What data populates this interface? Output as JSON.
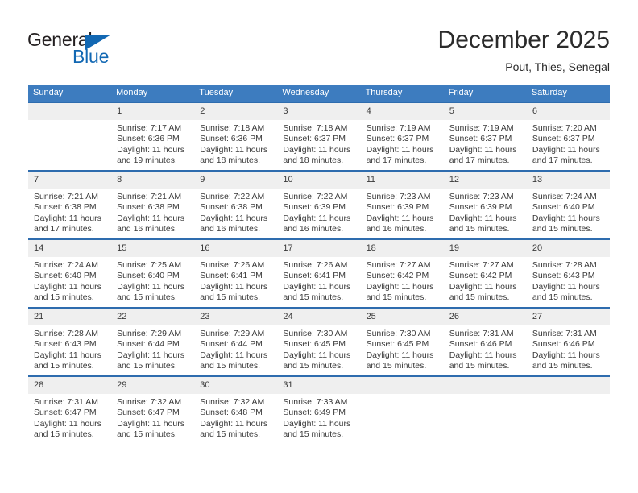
{
  "brand": {
    "name_top": "General",
    "name_bottom": "Blue",
    "triangle_color": "#1268b3",
    "text_color": "#231f20"
  },
  "header": {
    "month_title": "December 2025",
    "location": "Pout, Thies, Senegal"
  },
  "theme": {
    "header_blue": "#3d7cbf",
    "row_border_blue": "#2e6cae",
    "daynum_band": "#efefef",
    "text": "#3a3a3a"
  },
  "calendar": {
    "weekday_headers": [
      "Sunday",
      "Monday",
      "Tuesday",
      "Wednesday",
      "Thursday",
      "Friday",
      "Saturday"
    ],
    "weeks": [
      [
        {
          "day": "",
          "sunrise": "",
          "sunset": "",
          "daylight_line1": "",
          "daylight_line2": ""
        },
        {
          "day": "1",
          "sunrise": "Sunrise: 7:17 AM",
          "sunset": "Sunset: 6:36 PM",
          "daylight_line1": "Daylight: 11 hours",
          "daylight_line2": "and 19 minutes."
        },
        {
          "day": "2",
          "sunrise": "Sunrise: 7:18 AM",
          "sunset": "Sunset: 6:36 PM",
          "daylight_line1": "Daylight: 11 hours",
          "daylight_line2": "and 18 minutes."
        },
        {
          "day": "3",
          "sunrise": "Sunrise: 7:18 AM",
          "sunset": "Sunset: 6:37 PM",
          "daylight_line1": "Daylight: 11 hours",
          "daylight_line2": "and 18 minutes."
        },
        {
          "day": "4",
          "sunrise": "Sunrise: 7:19 AM",
          "sunset": "Sunset: 6:37 PM",
          "daylight_line1": "Daylight: 11 hours",
          "daylight_line2": "and 17 minutes."
        },
        {
          "day": "5",
          "sunrise": "Sunrise: 7:19 AM",
          "sunset": "Sunset: 6:37 PM",
          "daylight_line1": "Daylight: 11 hours",
          "daylight_line2": "and 17 minutes."
        },
        {
          "day": "6",
          "sunrise": "Sunrise: 7:20 AM",
          "sunset": "Sunset: 6:37 PM",
          "daylight_line1": "Daylight: 11 hours",
          "daylight_line2": "and 17 minutes."
        }
      ],
      [
        {
          "day": "7",
          "sunrise": "Sunrise: 7:21 AM",
          "sunset": "Sunset: 6:38 PM",
          "daylight_line1": "Daylight: 11 hours",
          "daylight_line2": "and 17 minutes."
        },
        {
          "day": "8",
          "sunrise": "Sunrise: 7:21 AM",
          "sunset": "Sunset: 6:38 PM",
          "daylight_line1": "Daylight: 11 hours",
          "daylight_line2": "and 16 minutes."
        },
        {
          "day": "9",
          "sunrise": "Sunrise: 7:22 AM",
          "sunset": "Sunset: 6:38 PM",
          "daylight_line1": "Daylight: 11 hours",
          "daylight_line2": "and 16 minutes."
        },
        {
          "day": "10",
          "sunrise": "Sunrise: 7:22 AM",
          "sunset": "Sunset: 6:39 PM",
          "daylight_line1": "Daylight: 11 hours",
          "daylight_line2": "and 16 minutes."
        },
        {
          "day": "11",
          "sunrise": "Sunrise: 7:23 AM",
          "sunset": "Sunset: 6:39 PM",
          "daylight_line1": "Daylight: 11 hours",
          "daylight_line2": "and 16 minutes."
        },
        {
          "day": "12",
          "sunrise": "Sunrise: 7:23 AM",
          "sunset": "Sunset: 6:39 PM",
          "daylight_line1": "Daylight: 11 hours",
          "daylight_line2": "and 15 minutes."
        },
        {
          "day": "13",
          "sunrise": "Sunrise: 7:24 AM",
          "sunset": "Sunset: 6:40 PM",
          "daylight_line1": "Daylight: 11 hours",
          "daylight_line2": "and 15 minutes."
        }
      ],
      [
        {
          "day": "14",
          "sunrise": "Sunrise: 7:24 AM",
          "sunset": "Sunset: 6:40 PM",
          "daylight_line1": "Daylight: 11 hours",
          "daylight_line2": "and 15 minutes."
        },
        {
          "day": "15",
          "sunrise": "Sunrise: 7:25 AM",
          "sunset": "Sunset: 6:40 PM",
          "daylight_line1": "Daylight: 11 hours",
          "daylight_line2": "and 15 minutes."
        },
        {
          "day": "16",
          "sunrise": "Sunrise: 7:26 AM",
          "sunset": "Sunset: 6:41 PM",
          "daylight_line1": "Daylight: 11 hours",
          "daylight_line2": "and 15 minutes."
        },
        {
          "day": "17",
          "sunrise": "Sunrise: 7:26 AM",
          "sunset": "Sunset: 6:41 PM",
          "daylight_line1": "Daylight: 11 hours",
          "daylight_line2": "and 15 minutes."
        },
        {
          "day": "18",
          "sunrise": "Sunrise: 7:27 AM",
          "sunset": "Sunset: 6:42 PM",
          "daylight_line1": "Daylight: 11 hours",
          "daylight_line2": "and 15 minutes."
        },
        {
          "day": "19",
          "sunrise": "Sunrise: 7:27 AM",
          "sunset": "Sunset: 6:42 PM",
          "daylight_line1": "Daylight: 11 hours",
          "daylight_line2": "and 15 minutes."
        },
        {
          "day": "20",
          "sunrise": "Sunrise: 7:28 AM",
          "sunset": "Sunset: 6:43 PM",
          "daylight_line1": "Daylight: 11 hours",
          "daylight_line2": "and 15 minutes."
        }
      ],
      [
        {
          "day": "21",
          "sunrise": "Sunrise: 7:28 AM",
          "sunset": "Sunset: 6:43 PM",
          "daylight_line1": "Daylight: 11 hours",
          "daylight_line2": "and 15 minutes."
        },
        {
          "day": "22",
          "sunrise": "Sunrise: 7:29 AM",
          "sunset": "Sunset: 6:44 PM",
          "daylight_line1": "Daylight: 11 hours",
          "daylight_line2": "and 15 minutes."
        },
        {
          "day": "23",
          "sunrise": "Sunrise: 7:29 AM",
          "sunset": "Sunset: 6:44 PM",
          "daylight_line1": "Daylight: 11 hours",
          "daylight_line2": "and 15 minutes."
        },
        {
          "day": "24",
          "sunrise": "Sunrise: 7:30 AM",
          "sunset": "Sunset: 6:45 PM",
          "daylight_line1": "Daylight: 11 hours",
          "daylight_line2": "and 15 minutes."
        },
        {
          "day": "25",
          "sunrise": "Sunrise: 7:30 AM",
          "sunset": "Sunset: 6:45 PM",
          "daylight_line1": "Daylight: 11 hours",
          "daylight_line2": "and 15 minutes."
        },
        {
          "day": "26",
          "sunrise": "Sunrise: 7:31 AM",
          "sunset": "Sunset: 6:46 PM",
          "daylight_line1": "Daylight: 11 hours",
          "daylight_line2": "and 15 minutes."
        },
        {
          "day": "27",
          "sunrise": "Sunrise: 7:31 AM",
          "sunset": "Sunset: 6:46 PM",
          "daylight_line1": "Daylight: 11 hours",
          "daylight_line2": "and 15 minutes."
        }
      ],
      [
        {
          "day": "28",
          "sunrise": "Sunrise: 7:31 AM",
          "sunset": "Sunset: 6:47 PM",
          "daylight_line1": "Daylight: 11 hours",
          "daylight_line2": "and 15 minutes."
        },
        {
          "day": "29",
          "sunrise": "Sunrise: 7:32 AM",
          "sunset": "Sunset: 6:47 PM",
          "daylight_line1": "Daylight: 11 hours",
          "daylight_line2": "and 15 minutes."
        },
        {
          "day": "30",
          "sunrise": "Sunrise: 7:32 AM",
          "sunset": "Sunset: 6:48 PM",
          "daylight_line1": "Daylight: 11 hours",
          "daylight_line2": "and 15 minutes."
        },
        {
          "day": "31",
          "sunrise": "Sunrise: 7:33 AM",
          "sunset": "Sunset: 6:49 PM",
          "daylight_line1": "Daylight: 11 hours",
          "daylight_line2": "and 15 minutes."
        },
        {
          "day": "",
          "sunrise": "",
          "sunset": "",
          "daylight_line1": "",
          "daylight_line2": ""
        },
        {
          "day": "",
          "sunrise": "",
          "sunset": "",
          "daylight_line1": "",
          "daylight_line2": ""
        },
        {
          "day": "",
          "sunrise": "",
          "sunset": "",
          "daylight_line1": "",
          "daylight_line2": ""
        }
      ]
    ]
  }
}
